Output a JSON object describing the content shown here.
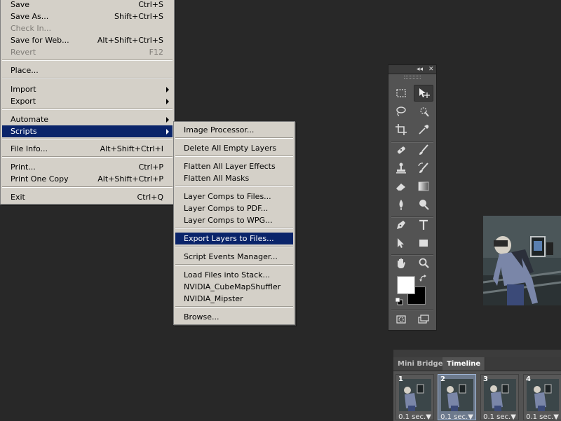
{
  "file_menu": {
    "items": [
      {
        "label": "Save",
        "shortcut": "Ctrl+S"
      },
      {
        "label": "Save As...",
        "shortcut": "Shift+Ctrl+S"
      },
      {
        "label": "Check In...",
        "shortcut": ""
      },
      {
        "label": "Save for Web...",
        "shortcut": "Alt+Shift+Ctrl+S"
      },
      {
        "label": "Revert",
        "shortcut": "F12"
      },
      {
        "label": "Place...",
        "shortcut": ""
      },
      {
        "label": "Import",
        "shortcut": ""
      },
      {
        "label": "Export",
        "shortcut": ""
      },
      {
        "label": "Automate",
        "shortcut": ""
      },
      {
        "label": "Scripts",
        "shortcut": ""
      },
      {
        "label": "File Info...",
        "shortcut": "Alt+Shift+Ctrl+I"
      },
      {
        "label": "Print...",
        "shortcut": "Ctrl+P"
      },
      {
        "label": "Print One Copy",
        "shortcut": "Alt+Shift+Ctrl+P"
      },
      {
        "label": "Exit",
        "shortcut": "Ctrl+Q"
      }
    ]
  },
  "scripts_menu": {
    "items": [
      {
        "label": "Image Processor..."
      },
      {
        "label": "Delete All Empty Layers"
      },
      {
        "label": "Flatten All Layer Effects"
      },
      {
        "label": "Flatten All Masks"
      },
      {
        "label": "Layer Comps to Files..."
      },
      {
        "label": "Layer Comps to PDF..."
      },
      {
        "label": "Layer Comps to WPG..."
      },
      {
        "label": "Export Layers to Files..."
      },
      {
        "label": "Script Events Manager..."
      },
      {
        "label": "Load Files into Stack..."
      },
      {
        "label": "NVIDIA_CubeMapShuffler"
      },
      {
        "label": "NVIDIA_Mipster"
      },
      {
        "label": "Browse..."
      }
    ]
  },
  "tools_panel": {
    "collapse_glyph": "◂◂",
    "close_glyph": "✕",
    "foreground_color": "#ffffff",
    "background_color": "#000000"
  },
  "timeline_panel": {
    "tabs": [
      {
        "label": "Mini Bridge"
      },
      {
        "label": "Timeline"
      }
    ],
    "frames": [
      {
        "number": "1",
        "delay": "0.1 sec.▼"
      },
      {
        "number": "2",
        "delay": "0.1 sec.▼"
      },
      {
        "number": "3",
        "delay": "0.1 sec.▼"
      },
      {
        "number": "4",
        "delay": "0.1 sec.▼"
      }
    ]
  }
}
